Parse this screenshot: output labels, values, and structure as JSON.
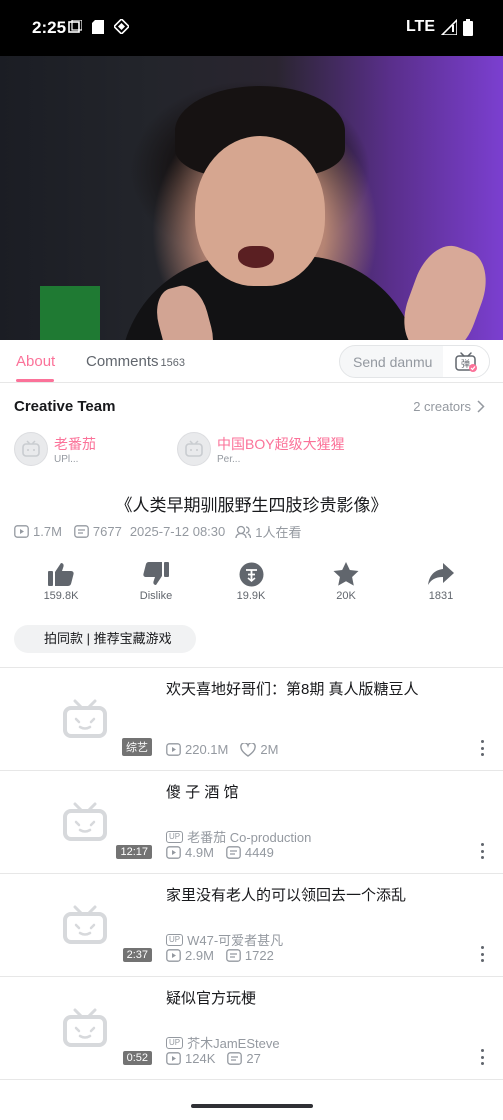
{
  "status_bar": {
    "time": "2:25",
    "network": "LTE"
  },
  "tabs": {
    "about": "About",
    "comments": "Comments",
    "comments_count": "1563",
    "danmu_placeholder": "Send danmu",
    "danmu_button": "弹"
  },
  "creative_team": {
    "title": "Creative Team",
    "count_label": "2 creators",
    "creators": [
      {
        "name": "老番茄",
        "role": "UPl..."
      },
      {
        "name": "中国BOY超级大猩猩",
        "role": "Per..."
      }
    ]
  },
  "video": {
    "title": "《人类早期驯服野生四肢珍贵影像》",
    "views": "1.7M",
    "danmaku": "7677",
    "date": "2025-7-12 08:30",
    "watching": "1人在看"
  },
  "actions": [
    {
      "icon": "thumbs-up-icon",
      "label": "159.8K"
    },
    {
      "icon": "thumbs-down-icon",
      "label": "Dislike"
    },
    {
      "icon": "coin-icon",
      "label": "19.9K"
    },
    {
      "icon": "star-icon",
      "label": "20K"
    },
    {
      "icon": "share-icon",
      "label": "1831"
    }
  ],
  "tag_chip": "拍同款 | 推荐宝藏游戏",
  "related": [
    {
      "title": "欢天喜地好哥们：第8期 真人版糖豆人",
      "badge": "综艺",
      "uploader": "",
      "views": "220.1M",
      "second_stat": "2M",
      "second_icon": "heart-icon"
    },
    {
      "title": "傻 子 酒 馆",
      "badge": "12:17",
      "uploader": "老番茄 Co-production",
      "views": "4.9M",
      "second_stat": "4449",
      "second_icon": "danmaku-icon"
    },
    {
      "title": "家里没有老人的可以领回去一个添乱",
      "badge": "2:37",
      "uploader": "W47-可爱者甚凡",
      "views": "2.9M",
      "second_stat": "1722",
      "second_icon": "danmaku-icon"
    },
    {
      "title": "疑似官方玩梗",
      "badge": "0:52",
      "uploader": "芥木JamESteve",
      "views": "124K",
      "second_stat": "27",
      "second_icon": "danmaku-icon"
    }
  ],
  "colors": {
    "accent": "#fb7299",
    "muted": "#9499a0"
  }
}
